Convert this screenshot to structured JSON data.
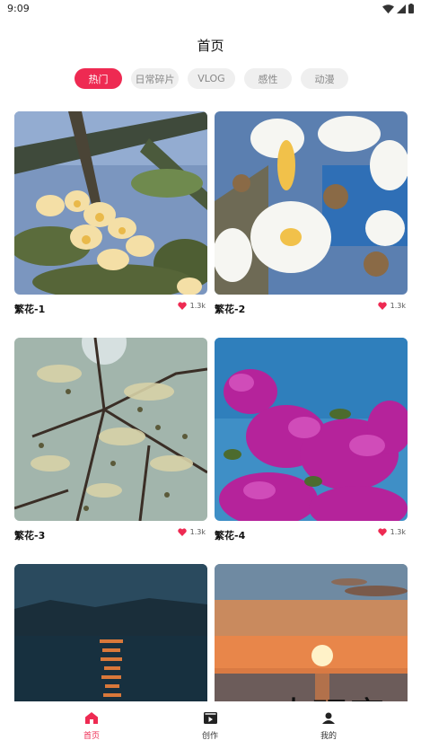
{
  "status_bar": {
    "time": "9:09"
  },
  "page_title": "首页",
  "tabs": [
    {
      "label": "热门",
      "active": true
    },
    {
      "label": "日常碎片",
      "active": false
    },
    {
      "label": "VLOG",
      "active": false
    },
    {
      "label": "感性",
      "active": false
    },
    {
      "label": "动漫",
      "active": false
    }
  ],
  "cards": [
    {
      "name": "繁花-1",
      "likes": "1.3k"
    },
    {
      "name": "繁花-2",
      "likes": "1.3k"
    },
    {
      "name": "繁花-3",
      "likes": "1.3k"
    },
    {
      "name": "繁花-4",
      "likes": "1.3k"
    }
  ],
  "bottom_nav": [
    {
      "label": "首页",
      "icon": "home-icon",
      "active": true
    },
    {
      "label": "创作",
      "icon": "video-icon",
      "active": false
    },
    {
      "label": "我的",
      "icon": "profile-icon",
      "active": false
    }
  ],
  "watermark": "大玩客",
  "colors": {
    "accent": "#ee2a52",
    "tab_bg": "#efefef"
  }
}
